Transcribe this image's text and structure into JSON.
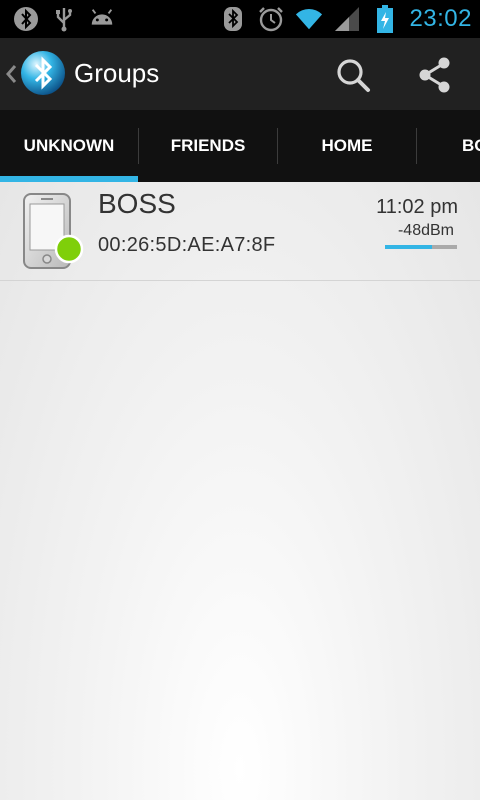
{
  "status_bar": {
    "left_icons": [
      "bluetooth-app-notification-icon",
      "usb-icon",
      "android-debug-icon"
    ],
    "right_icons": [
      "bluetooth-icon",
      "alarm-icon",
      "wifi-icon",
      "cell-signal-icon",
      "battery-charging-icon"
    ],
    "time": "23:02",
    "accent_color": "#33b5e5"
  },
  "action_bar": {
    "title": "Groups",
    "actions": [
      "search-icon",
      "share-icon"
    ]
  },
  "tabs": [
    {
      "label": "UNKNOWN",
      "selected": true
    },
    {
      "label": "FRIENDS",
      "selected": false
    },
    {
      "label": "HOME",
      "selected": false
    },
    {
      "label": "BO",
      "selected": false
    }
  ],
  "devices": [
    {
      "name": "BOSS",
      "mac": "00:26:5D:AE:A7:8F",
      "time": "11:02 pm",
      "rssi": "-48dBm",
      "signal_fraction": 0.65,
      "status_color": "#7fcf0a"
    }
  ]
}
